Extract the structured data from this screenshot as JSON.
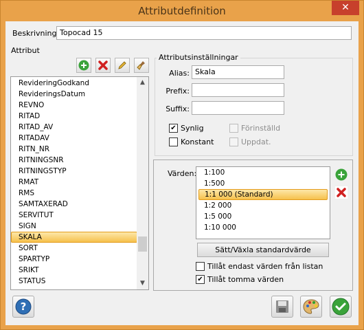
{
  "window": {
    "title": "Attributdefinition",
    "close_label": "✕"
  },
  "description": {
    "label": "Beskrivning:",
    "value": "Topocad 15"
  },
  "attributes": {
    "label": "Attribut",
    "toolbar": [
      "add-icon",
      "delete-icon",
      "edit-icon",
      "clear-icon"
    ],
    "items": [
      "RevideringGodkand",
      "RevideringsDatum",
      "REVNO",
      "RITAD",
      "RITAD_AV",
      "RITADAV",
      "RITN_NR",
      "RITNINGSNR",
      "RITNINGSTYP",
      "RMAT",
      "RMS",
      "SAMTAXERAD",
      "SERVITUT",
      "SIGN",
      "SKALA",
      "SORT",
      "SPARTYP",
      "SRIKT",
      "STATUS"
    ],
    "selected": "SKALA"
  },
  "settings": {
    "group_title": "Attributsinställningar",
    "alias": {
      "label": "Alias:",
      "value": "Skala"
    },
    "prefix": {
      "label": "Prefix:",
      "value": ""
    },
    "suffix": {
      "label": "Suffix:",
      "value": ""
    },
    "synlig": {
      "label": "Synlig",
      "checked": true
    },
    "konstant": {
      "label": "Konstant",
      "checked": false
    },
    "forinstalld": {
      "label": "Förinställd",
      "checked": false
    },
    "uppdat": {
      "label": "Uppdat.",
      "checked": false
    }
  },
  "values": {
    "label": "Värden:",
    "items": [
      "1:100",
      "1:500",
      "1:1 000 (Standard)",
      "1:2 000",
      "1:5 000",
      "1:10 000"
    ],
    "selected": "1:1 000 (Standard)",
    "std_button": "Sätt/Växla standardvärde",
    "only_list": {
      "label": "Tillåt endast värden från listan",
      "checked": false
    },
    "allow_empty": {
      "label": "Tillåt tomma värden",
      "checked": true
    }
  },
  "bottom_buttons": [
    "help-icon",
    "save-icon",
    "palette-icon",
    "ok-icon"
  ],
  "colors": {
    "accent": "#e9a24a",
    "selection": "#f6c14c",
    "add": "#3aa33a",
    "delete": "#d02020"
  }
}
